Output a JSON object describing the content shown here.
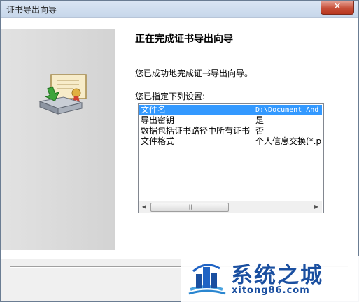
{
  "window": {
    "title": "证书导出向导",
    "close_symbol": "✕"
  },
  "page": {
    "heading": "正在完成证书导出向导",
    "message": "您已成功地完成证书导出向导。",
    "list_label": "您已指定下列设置:"
  },
  "settings": [
    {
      "key": "文件名",
      "value": "D:\\Document And",
      "selected": true
    },
    {
      "key": "导出密钥",
      "value": "是",
      "selected": false
    },
    {
      "key": "数据包括证书路径中所有证书",
      "value": "否",
      "selected": false
    },
    {
      "key": "文件格式",
      "value": "个人信息交换(*.p",
      "selected": false
    }
  ],
  "scrollbar": {
    "left_arrow": "◀",
    "right_arrow": "▶",
    "grip": "|||"
  },
  "watermark": {
    "brand": "系统之城",
    "url": "xitong86.com"
  },
  "colors": {
    "selection": "#3399ff",
    "watermark": "#1a4fa0"
  }
}
